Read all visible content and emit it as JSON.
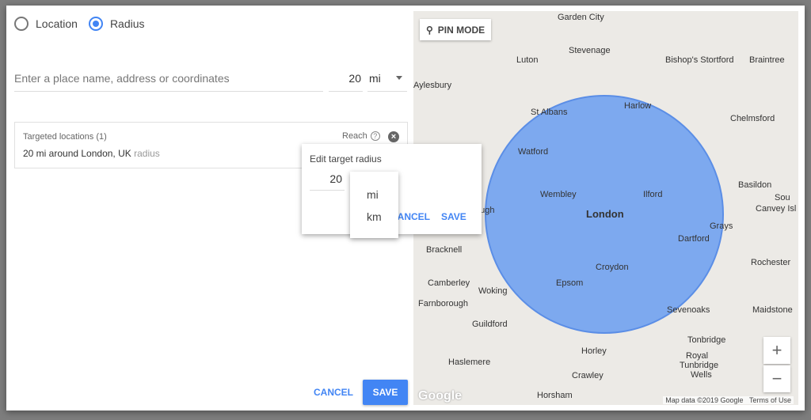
{
  "radio": {
    "location": "Location",
    "radius": "Radius",
    "selected": "radius"
  },
  "search": {
    "placeholder": "Enter a place name, address or coordinates",
    "radius_value": "20",
    "unit": "mi"
  },
  "targeted": {
    "title": "Targeted locations (1)",
    "item": "20 mi around London, UK",
    "item_type": "radius",
    "reach": "Reach",
    "help": "?",
    "remove": "×"
  },
  "edit_popup": {
    "title": "Edit target radius",
    "value": "20",
    "cancel": "CANCEL",
    "save": "SAVE"
  },
  "unit_menu": [
    "mi",
    "km"
  ],
  "footer": {
    "cancel": "CANCEL",
    "save": "SAVE"
  },
  "map": {
    "pin_mode": "PIN MODE",
    "zoom_in": "+",
    "zoom_out": "−",
    "logo": "Google",
    "attribution": "Map data ©2019 Google",
    "terms": "Terms of Use",
    "circle_color": "#4285f4",
    "places": [
      "Garden City",
      "Stevenage",
      "Luton",
      "Bishop's Stortford",
      "Braintree",
      "Aylesbury",
      "Harlow",
      "St Albans",
      "Chelmsford",
      "Watford",
      "Basildon",
      "Wembley",
      "Ilford",
      "London",
      "Sou",
      "Canvey Isl",
      "Grays",
      "ough",
      "Bracknell",
      "Dartford",
      "Rochester",
      "Croydon",
      "Camberley",
      "Woking",
      "Epsom",
      "Farnborough",
      "Maidstone",
      "Sevenoaks",
      "Guildford",
      "Tonbridge",
      "Horley",
      "Royal",
      "Tunbridge",
      "Wells",
      "Haslemere",
      "Crawley",
      "Horsham"
    ]
  }
}
